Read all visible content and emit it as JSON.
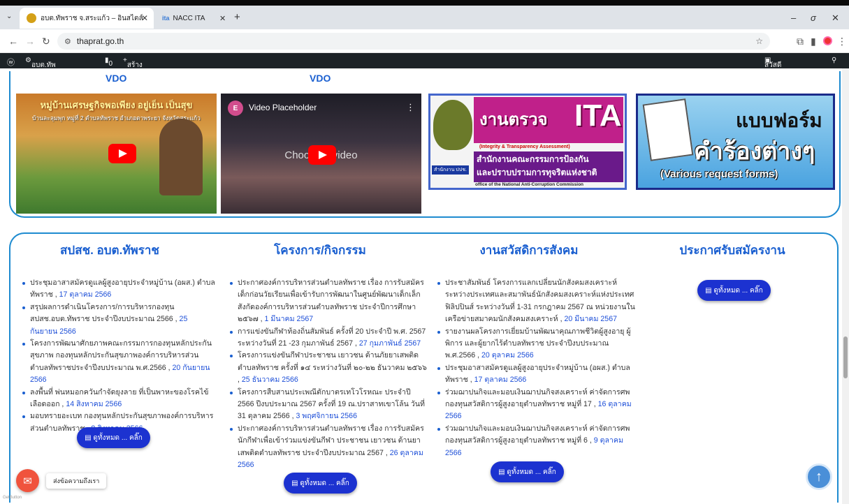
{
  "browser": {
    "tabs": [
      {
        "title": "อบต.ทัพราช จ.สระแก้ว – อินสไตล์"
      },
      {
        "title": "NACC ITA"
      }
    ],
    "new_tab": "+",
    "url": "thaprat.go.th"
  },
  "wp_admin": {
    "site": "อบต.ทัพราช จ.สระแก้ว ...",
    "comments": "0",
    "new_label": "สร้างใหม่",
    "greeting": "สวัสดี สำนักปลัด"
  },
  "videos": {
    "heading_1": "VDO",
    "heading_2": "VDO",
    "video1_title": "หมู่บ้านเศรษฐกิจพอเพียง อยู่เย็น เป็นสุข",
    "video1_sub": "บ้านละลุมพุก หมู่ที่ 2 ตำบลทัพราช อำเภอตาพระยา จังหวัดสระแก้ว",
    "video2_title": "Video Placeholder",
    "video2_center": "Choose a video"
  },
  "banners": {
    "ita": {
      "title": "งานตรวจ",
      "big": "ITA",
      "subtitle": "(Integrity & Transparency Assessment)",
      "org_th": "สำนักงานคณะกรรมการป้องกัน",
      "org_th2": "และปราบปรามการทุจริตแห่งชาติ",
      "org_en": "office of the National Anti-Corruption Commission",
      "badge": "สำนักงาน ปปช."
    },
    "forms": {
      "line1": "แบบฟอร์ม",
      "line2": "คำร้องต่างๆ",
      "line3": "(Various request forms)"
    }
  },
  "columns": [
    {
      "title": "สปสช. อบต.ทัพราช",
      "items": [
        {
          "text": "ประชุมอาสาสมัครดูแลผู้สูงอายุประจำหมู่บ้าน (อผส.) ตำบลทัพราช ,",
          "date": "17 ตุลาคม 2566"
        },
        {
          "text": "สรุปผลการดำเนินโครงการ/การบริหารกองทุนสปสช.อบต.ทัพราช ประจำปีงบประมาณ 2566 ,",
          "date": "25 กันยายน 2566"
        },
        {
          "text": "โครงการพัฒนาศักยภาพคณะกรรมการกองทุนหลักประกันสุขภาพ กองทุนหลักประกันสุขภาพองค์การบริหารส่วนตำบลทัพราชประจำปีงบประมาณ พ.ศ.2566 ,",
          "date": "20 กันยายน 2566"
        },
        {
          "text": "ลงพื้นที่ พ่นหมอกควันกำจัดยุงลาย ที่เป็นพาหะของโรคไข้เลือดออก ,",
          "date": "14 สิงหาคม 2566"
        },
        {
          "text": "มอบทรายอะเบท กองทุนหลักประกันสุขภาพองค์การบริหารส่วนตำบลทัพราช ,",
          "date": "8 สิงหาคม 2566"
        }
      ],
      "button": "ดูทั้งหมด ... คลิ๊ก"
    },
    {
      "title": "โครงการ/กิจกรรม",
      "items": [
        {
          "text": "ประกาศองค์การบริหารส่วนตำบลทัพราช เรื่อง การรับสมัครเด็กก่อนวัยเรียนเพื่อเข้ารับการพัฒนาในศูนย์พัฒนาเด็กเล็กสังกัดองค์การบริหารส่วนตำบลทัพราช ประจำปีการศึกษา ๒๕๖๗ ,",
          "date": "1 มีนาคม 2567"
        },
        {
          "text": "การแข่งขันกีฬาท้องถิ่นสัมพันธ์ ครั้งที่ 20 ประจำปี พ.ศ. 2567 ระหว่างวันที่ 21 -23 กุมภาพันธ์ 2567 ,",
          "date": "27 กุมภาพันธ์ 2567"
        },
        {
          "text": "โครงการแข่งขันกีฬาประชาชน เยาวชน ต้านภัยยาเสพติดตำบลทัพราช ครั้งที่ ๑๔ ระหว่างวันที่ ๒๐-๒๒ ธันวาคม ๒๕๖๖ ,",
          "date": "25 ธันวาคม 2566"
        },
        {
          "text": "โครงการสืบสานประเพณีตักบาตรเทโวโรหณะ ประจำปี 2566 ปีงบประมาณ 2567 ครั้งที่ 19 ณ.ปราสาทเขาโล้น วันที่ 31 ตุลาคม 2566 ,",
          "date": "3 พฤศจิกายน 2566"
        },
        {
          "text": "ประกาศองค์การบริหารส่วนตำบลทัพราช เรื่อง การรับสมัครนักกีฬาเพื่อเข้าร่วมแข่งขันกีฬา ประชาชน เยาวชน ต้านยาเสพติดตำบลทัพราช ประจำปีงบประมาณ 2567 ,",
          "date": "26 ตุลาคม 2566"
        }
      ],
      "button": "ดูทั้งหมด ... คลิ๊ก"
    },
    {
      "title": "งานสวัสดิการสังคม",
      "items": [
        {
          "text": "ประชาสัมพันธ์ โครงการแลกเปลี่ยนนักสังคมสงเคราะห์ ระหว่างประเทศและสมาพันธ์นักสังคมสงเคราะห์แห่งประเทศฟิลิปปินส์ ระหว่างวันที่ 1-31 กรกฎาคม 2567 ณ หน่วยงานในเครือข่ายสมาคมนักสังคมสงเคราะห์ ,",
          "date": "20 มีนาคม 2567"
        },
        {
          "text": "รายงานผลโครงการเยี่ยมบ้านพัฒนาคุณภาพชีวิตผู้สูงอายุ ผู้พิการ และผู้ยากไร้ตำบลทัพราช ประจำปีงบประมาณ พ.ศ.2566 ,",
          "date": "20 ตุลาคม 2566"
        },
        {
          "text": "ประชุมอาสาสมัครดูแลผู้สูงอายุประจำหมู่บ้าน (อผส.) ตำบลทัพราช ,",
          "date": "17 ตุลาคม 2566"
        },
        {
          "text": "ร่วมฌาปนกิจและมอบเงินฌาปนกิจสงเคราะห์ ค่าจัดการศพ กองทุนสวัสดิการผู้สูงอายุตำบลทัพราช หมู่ที่ 17 ,",
          "date": "16 ตุลาคม 2566"
        },
        {
          "text": "ร่วมฌาปนกิจและมอบเงินฌาปนกิจสงเคราะห์ ค่าจัดการศพ กองทุนสวัสดิการผู้สูงอายุตำบลทัพราช หมู่ที่ 6 ,",
          "date": "9 ตุลาคม 2566"
        }
      ],
      "button": "ดูทั้งหมด ... คลิ๊ก"
    },
    {
      "title": "ประกาศรับสมัครงาน",
      "items": [],
      "button": "ดูทั้งหมด ... คลิ๊ก"
    }
  ],
  "chat": {
    "label": "ส่งข้อความถึงเรา",
    "brand": "GetButton"
  },
  "colors": {
    "accent": "#1a5fd0",
    "button": "#1c32d0",
    "border": "#1e8bd0",
    "chat": "#f0533d",
    "scrolltop": "#4a8fd8"
  }
}
